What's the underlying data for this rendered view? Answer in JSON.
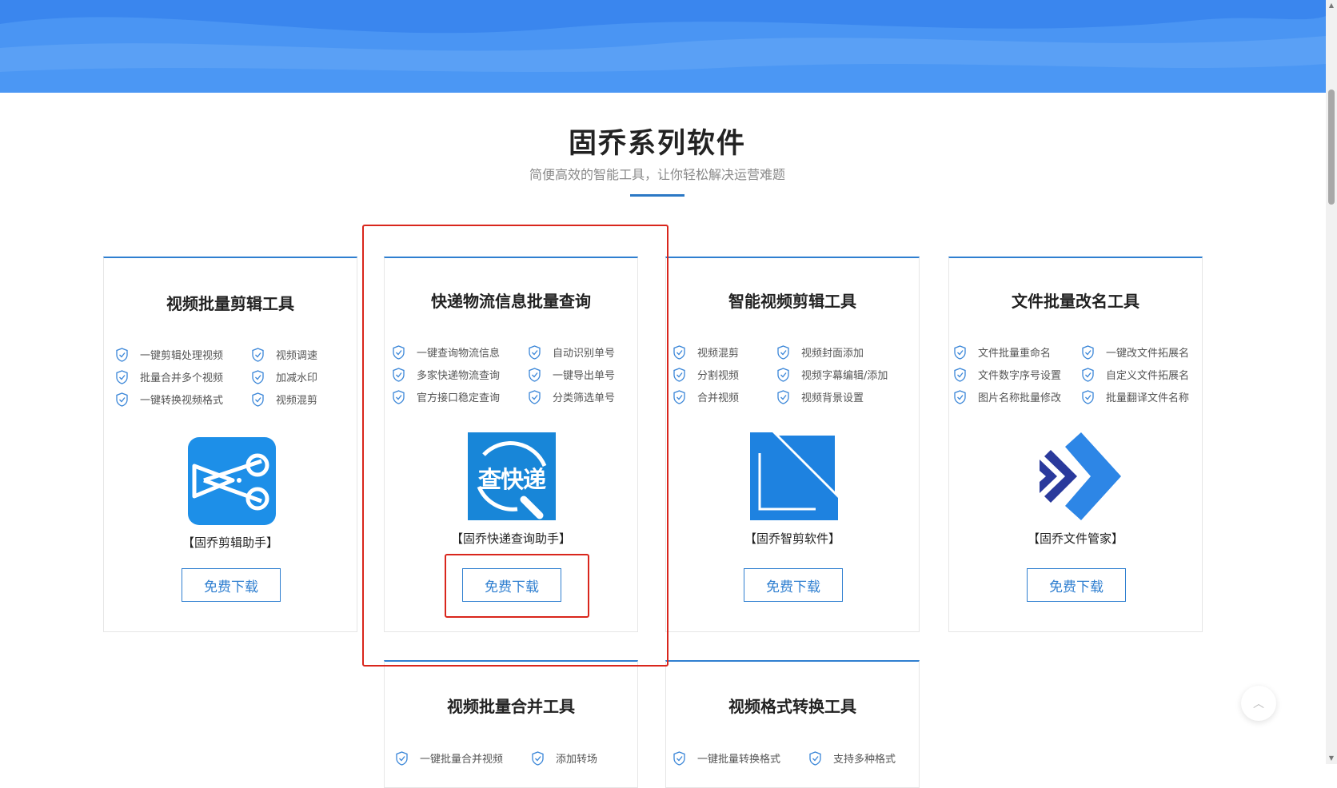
{
  "section": {
    "title": "固乔系列软件",
    "subtitle": "简便高效的智能工具，让你轻松解决运营难题"
  },
  "cards": [
    {
      "title": "视频批量剪辑工具",
      "features": [
        "一键剪辑处理视频",
        "视频调速",
        "批量合并多个视频",
        "加减水印",
        "一键转换视频格式",
        "视频混剪"
      ],
      "logo_icon": "scissors-icon",
      "product_name": "【固乔剪辑助手】",
      "button_label": "免费下载"
    },
    {
      "title": "快递物流信息批量查询",
      "features": [
        "一键查询物流信息",
        "自动识别单号",
        "多家快递物流查询",
        "一键导出单号",
        "官方接口稳定查询",
        "分类筛选单号"
      ],
      "logo_icon": "express-search-icon",
      "logo_text": "查快递",
      "product_name": "【固乔快递查询助手】",
      "button_label": "免费下载"
    },
    {
      "title": "智能视频剪辑工具",
      "features": [
        "视频混剪",
        "视频封面添加",
        "分割视频",
        "视频字幕编辑/添加",
        "合并视频",
        "视频背景设置"
      ],
      "logo_icon": "smart-cut-icon",
      "product_name": "【固乔智剪软件】",
      "button_label": "免费下载"
    },
    {
      "title": "文件批量改名工具",
      "features": [
        "文件批量重命名",
        "一键改文件拓展名",
        "文件数字序号设置",
        "自定义文件拓展名",
        "图片名称批量修改",
        "批量翻译文件名称"
      ],
      "logo_icon": "file-manager-icon",
      "product_name": "【固乔文件管家】",
      "button_label": "免费下载"
    },
    {
      "title": "视频批量合并工具",
      "features": [
        "一键批量合并视频",
        "添加转场"
      ]
    },
    {
      "title": "视频格式转换工具",
      "features": [
        "一键批量转换格式",
        "支持多种格式"
      ]
    }
  ],
  "colors": {
    "accent": "#2f7fd0",
    "highlight": "#d9261c",
    "banner": "#3f8ff0"
  }
}
